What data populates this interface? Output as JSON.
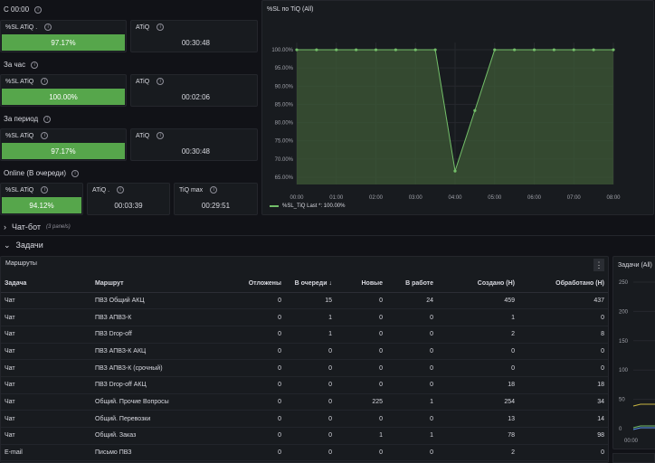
{
  "sections": {
    "since_midnight": "С 00:00",
    "hour": "За час",
    "period": "За период",
    "online": "Online (В очереди)"
  },
  "stats": {
    "r1": {
      "sl_title": "%SL ATiQ .",
      "sl_value": "97.17%",
      "atiq_title": "ATiQ",
      "atiq_value": "00:30:48"
    },
    "r2": {
      "sl_title": "%SL ATiQ",
      "sl_value": "100.00%",
      "atiq_title": "ATiQ",
      "atiq_value": "00:02:06"
    },
    "r3": {
      "sl_title": "%SL ATiQ",
      "sl_value": "97.17%",
      "atiq_title": "ATiQ",
      "atiq_value": "00:30:48"
    },
    "r4": {
      "sl_title": "%SL ATiQ",
      "sl_value": "94.12%",
      "atiq_title": "ATiQ .",
      "atiq_value": "00:03:39",
      "max_title": "TiQ max",
      "max_value": "00:29:51"
    }
  },
  "chart_data": {
    "type": "area",
    "title": "%SL по TiQ (All)",
    "x": [
      "00:00",
      "00:30",
      "01:00",
      "01:30",
      "02:00",
      "02:30",
      "03:00",
      "03:30",
      "04:00",
      "04:30",
      "05:00",
      "05:30",
      "06:00",
      "06:30",
      "07:00",
      "07:30",
      "08:00"
    ],
    "x_ticks": [
      "00:00",
      "01:00",
      "02:00",
      "03:00",
      "04:00",
      "05:00",
      "06:00",
      "07:00",
      "08:00"
    ],
    "series": [
      {
        "name": "%SL_TiQ",
        "values": [
          100,
          100,
          100,
          100,
          100,
          100,
          100,
          100,
          66.7,
          83.3,
          100,
          100,
          100,
          100,
          100,
          100,
          100
        ]
      }
    ],
    "y_ticks": [
      "100.00%",
      "95.00%",
      "90.00%",
      "85.00%",
      "80.00%",
      "75.00%",
      "70.00%",
      "65.00%"
    ],
    "ylim": [
      63,
      102
    ],
    "legend_text": "%SL_TiQ  Last *: 100.00%",
    "color": "#73bf69"
  },
  "rows": {
    "chatbot_label": "Чат-бот",
    "chatbot_count": "(3 panels)",
    "tasks_label": "Задачи"
  },
  "routes": {
    "title": "Маршруты",
    "menu_icon": "⋮",
    "columns": [
      "Задача",
      "Маршрут",
      "Отложены",
      "В очереди ↓",
      "Новые",
      "В работе",
      "Создано (Н)",
      "Обработано (Н)"
    ],
    "rows": [
      [
        "Чат",
        "ПВЗ Общий АКЦ",
        "0",
        "15",
        "0",
        "24",
        "459",
        "437"
      ],
      [
        "Чат",
        "ПВЗ АПВЗ-К",
        "0",
        "1",
        "0",
        "0",
        "1",
        "0"
      ],
      [
        "Чат",
        "ПВЗ Drop-off",
        "0",
        "1",
        "0",
        "0",
        "2",
        "8"
      ],
      [
        "Чат",
        "ПВЗ АПВЗ-К АКЦ",
        "0",
        "0",
        "0",
        "0",
        "0",
        "0"
      ],
      [
        "Чат",
        "ПВЗ АПВЗ-К (срочный)",
        "0",
        "0",
        "0",
        "0",
        "0",
        "0"
      ],
      [
        "Чат",
        "ПВЗ Drop-off АКЦ",
        "0",
        "0",
        "0",
        "0",
        "18",
        "18"
      ],
      [
        "Чат",
        "Общий. Прочие Вопросы",
        "0",
        "0",
        "225",
        "1",
        "254",
        "34"
      ],
      [
        "Чат",
        "Общий. Перевозки",
        "0",
        "0",
        "0",
        "0",
        "13",
        "14"
      ],
      [
        "Чат",
        "Общий. Заказ",
        "0",
        "0",
        "1",
        "1",
        "78",
        "98"
      ],
      [
        "E-mail",
        "Письмо ПВЗ",
        "0",
        "0",
        "0",
        "0",
        "2",
        "0"
      ]
    ]
  },
  "tasks_panel": {
    "title": "Задачи (All)",
    "y_ticks": [
      "250",
      "200",
      "150",
      "100",
      "50",
      "0"
    ],
    "x_tick": "00:00"
  }
}
